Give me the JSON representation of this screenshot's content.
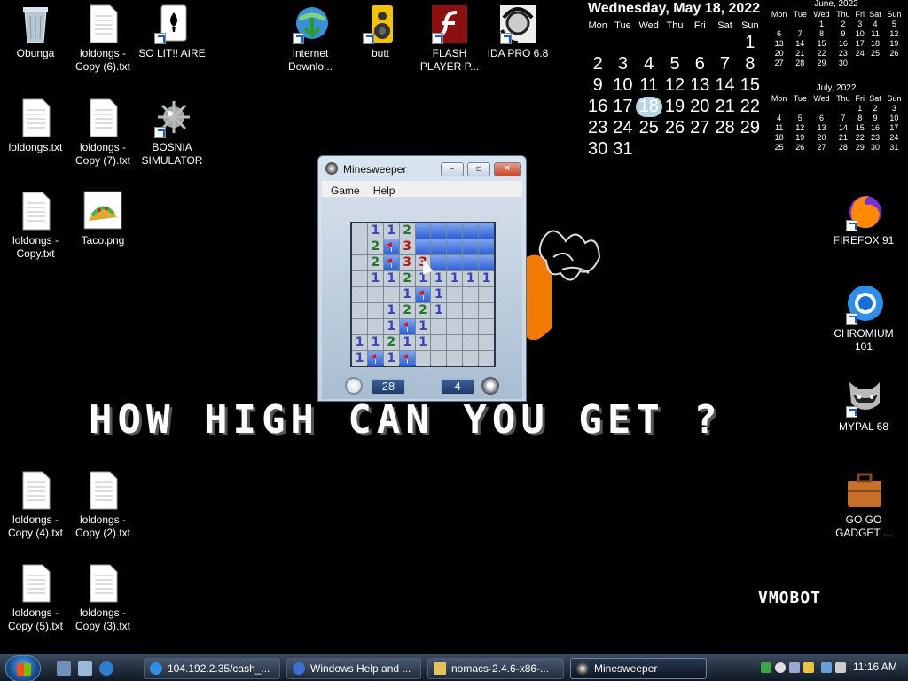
{
  "desktop": {
    "icons": [
      {
        "label": "Obunga"
      },
      {
        "label": "loldongs - Copy (6).txt"
      },
      {
        "label": "SO LIT!! AIRE"
      },
      {
        "label": "Internet Downlo..."
      },
      {
        "label": "butt"
      },
      {
        "label": "FLASH PLAYER P..."
      },
      {
        "label": "IDA PRO 6.8"
      },
      {
        "label": "loldongs.txt"
      },
      {
        "label": "loldongs - Copy (7).txt"
      },
      {
        "label": "BOSNIA SIMULATOR"
      },
      {
        "label": "loldongs - Copy.txt"
      },
      {
        "label": "Taco.png"
      },
      {
        "label": "FIREFOX 91"
      },
      {
        "label": "CHROMIUM 101"
      },
      {
        "label": "MYPAL 68"
      },
      {
        "label": "GO GO GADGET ..."
      },
      {
        "label": "loldongs - Copy (4).txt"
      },
      {
        "label": "loldongs - Copy (2).txt"
      },
      {
        "label": "loldongs - Copy (5).txt"
      },
      {
        "label": "loldongs - Copy (3).txt"
      }
    ],
    "wallpaper_text": "HOW HIGH CAN YOU GET ?",
    "wallpaper_brand": "VMOBOT"
  },
  "calendar": {
    "main": {
      "title": "Wednesday, May 18, 2022",
      "weekdays": [
        "Mon",
        "Tue",
        "Wed",
        "Thu",
        "Fri",
        "Sat",
        "Sun"
      ],
      "weeks": [
        [
          "",
          "",
          "",
          "",
          "",
          "",
          "1"
        ],
        [
          "2",
          "3",
          "4",
          "5",
          "6",
          "7",
          "8"
        ],
        [
          "9",
          "10",
          "11",
          "12",
          "13",
          "14",
          "15"
        ],
        [
          "16",
          "17",
          "18",
          "19",
          "20",
          "21",
          "22"
        ],
        [
          "23",
          "24",
          "25",
          "26",
          "27",
          "28",
          "29"
        ],
        [
          "30",
          "31",
          "",
          "",
          "",
          "",
          ""
        ]
      ],
      "today": "18"
    },
    "june": {
      "title": "June, 2022",
      "weekdays": [
        "Mon",
        "Tue",
        "Wed",
        "Thu",
        "Fri",
        "Sat",
        "Sun"
      ],
      "weeks": [
        [
          "",
          "",
          "1",
          "2",
          "3",
          "4",
          "5"
        ],
        [
          "6",
          "7",
          "8",
          "9",
          "10",
          "11",
          "12"
        ],
        [
          "13",
          "14",
          "15",
          "16",
          "17",
          "18",
          "19"
        ],
        [
          "20",
          "21",
          "22",
          "23",
          "24",
          "25",
          "26"
        ],
        [
          "27",
          "28",
          "29",
          "30",
          "",
          "",
          ""
        ]
      ]
    },
    "july": {
      "title": "July, 2022",
      "weekdays": [
        "Mon",
        "Tue",
        "Wed",
        "Thu",
        "Fri",
        "Sat",
        "Sun"
      ],
      "weeks": [
        [
          "",
          "",
          "",
          "",
          "1",
          "2",
          "3"
        ],
        [
          "4",
          "5",
          "6",
          "7",
          "8",
          "9",
          "10"
        ],
        [
          "11",
          "12",
          "13",
          "14",
          "15",
          "16",
          "17"
        ],
        [
          "18",
          "19",
          "20",
          "21",
          "22",
          "23",
          "24"
        ],
        [
          "25",
          "26",
          "27",
          "28",
          "29",
          "30",
          "31"
        ]
      ]
    }
  },
  "minesweeper": {
    "title": "Minesweeper",
    "menu": [
      "Game",
      "Help"
    ],
    "board": [
      [
        " ",
        "1",
        "1",
        "2",
        "#",
        "#",
        "#",
        "#",
        "#"
      ],
      [
        " ",
        "2",
        "F",
        "3",
        "#",
        "#",
        "#",
        "#",
        "#"
      ],
      [
        " ",
        "2",
        "F",
        "3",
        "3",
        "#",
        "#",
        "#",
        "#"
      ],
      [
        " ",
        "1",
        "1",
        "2",
        "1",
        "1",
        "1",
        "1",
        "1"
      ],
      [
        " ",
        " ",
        " ",
        "1",
        "F",
        "1",
        " ",
        " ",
        " "
      ],
      [
        " ",
        " ",
        "1",
        "2",
        "2",
        "1",
        " ",
        " ",
        " "
      ],
      [
        " ",
        " ",
        "1",
        "F",
        "1",
        " ",
        " ",
        " ",
        " "
      ],
      [
        "1",
        "1",
        "2",
        "1",
        "1",
        " ",
        " ",
        " ",
        " "
      ],
      [
        "1",
        "F",
        "1",
        "F",
        " ",
        " ",
        " ",
        " ",
        " "
      ]
    ],
    "time": "28",
    "mines_left": "4"
  },
  "taskbar": {
    "tasks": [
      {
        "label": "104.192.2.35/cash_..."
      },
      {
        "label": "Windows Help and ..."
      },
      {
        "label": "nomacs-2.4.6-x86-..."
      },
      {
        "label": "Minesweeper"
      }
    ],
    "clock": "11:16 AM"
  },
  "colors": {
    "hidden_tile": "#2f5fd5",
    "open_tile": "#c5cdd6",
    "flag": "#e01818"
  }
}
